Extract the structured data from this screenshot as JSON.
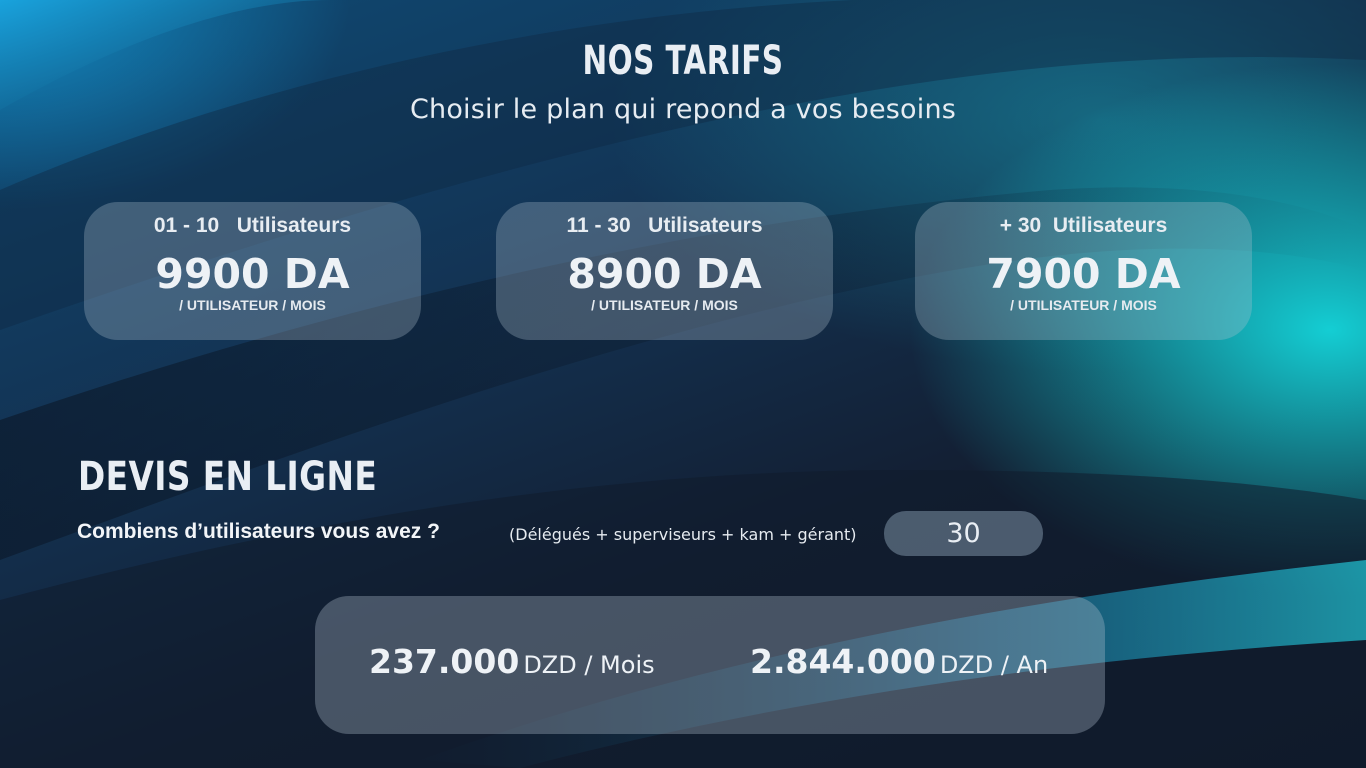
{
  "header": {
    "title": "NOS TARIFS",
    "subtitle": "Choisir le plan qui repond a vos besoins"
  },
  "plans": [
    {
      "users": "01 - 10   Utilisateurs",
      "price": "9900 DA",
      "per": "/ UTILISATEUR / MOIS"
    },
    {
      "users": "11 - 30   Utilisateurs",
      "price": "8900 DA",
      "per": "/ UTILISATEUR / MOIS"
    },
    {
      "users": "+ 30  Utilisateurs",
      "price": "7900 DA",
      "per": "/ UTILISATEUR / MOIS"
    }
  ],
  "quote": {
    "title": "DEVIS EN LIGNE",
    "question": "Combiens d’utilisateurs vous avez ?",
    "hint": "(Délégués + superviseurs + kam + gérant)",
    "user_count": "30"
  },
  "totals": {
    "monthly_amount": "237.000",
    "monthly_unit": "DZD / Mois",
    "yearly_amount": "2.844.000",
    "yearly_unit": "DZD / An"
  },
  "colors": {
    "accent_cyan": "#14d7dc",
    "background_dark": "#102338",
    "text": "#eef2f6"
  }
}
